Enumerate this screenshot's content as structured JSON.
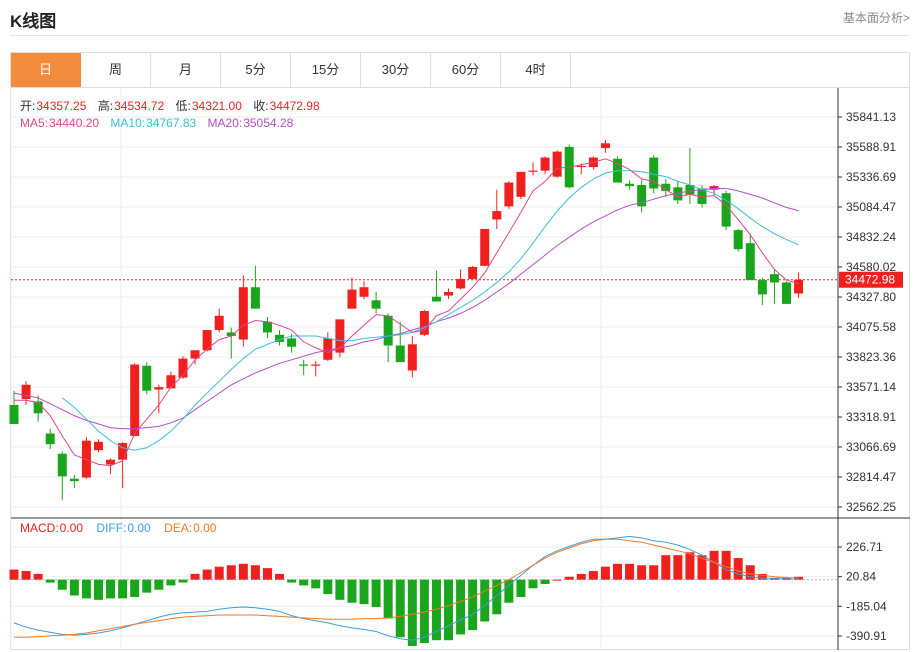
{
  "header": {
    "title": "K线图",
    "link": "基本面分析>"
  },
  "tabs": [
    "日",
    "周",
    "月",
    "5分",
    "15分",
    "30分",
    "60分",
    "4时"
  ],
  "active_tab": 0,
  "ohlc": {
    "open_label": "开:",
    "open": "34357.25",
    "high_label": "高:",
    "high": "34534.72",
    "low_label": "低:",
    "low": "34321.00",
    "close_label": "收:",
    "close": "34472.98"
  },
  "ma": {
    "ma5_label": "MA5:",
    "ma5": "34440.20",
    "ma10_label": "MA10:",
    "ma10": "34767.83",
    "ma20_label": "MA20:",
    "ma20": "35054.28"
  },
  "macd_legend": {
    "macd_label": "MACD:",
    "macd": "0.00",
    "diff_label": "DIFF:",
    "diff": "0.00",
    "dea_label": "DEA:",
    "dea": "0.00"
  },
  "colors": {
    "up": "#f0201e",
    "down": "#19a51c",
    "ma5": "#e0448c",
    "ma10": "#3bbfd6",
    "ma20": "#b14fc5",
    "diff": "#3b9fe0",
    "dea": "#f07a20",
    "accent": "#f28b3c"
  },
  "chart_data": [
    {
      "type": "candlestick",
      "y_ticks": [
        35841.13,
        35588.91,
        35336.69,
        35084.47,
        34832.24,
        34580.02,
        34327.8,
        34075.58,
        33823.36,
        33571.14,
        33318.91,
        33066.69,
        32814.47,
        32562.25
      ],
      "ylim": [
        32562.25,
        35841.13
      ],
      "last_price": "34472.98",
      "candles": [
        {
          "o": 33420,
          "h": 33540,
          "l": 33280,
          "c": 33260
        },
        {
          "o": 33470,
          "h": 33620,
          "l": 33420,
          "c": 33590
        },
        {
          "o": 33450,
          "h": 33500,
          "l": 33280,
          "c": 33350
        },
        {
          "o": 33180,
          "h": 33220,
          "l": 33050,
          "c": 33090
        },
        {
          "o": 33010,
          "h": 33030,
          "l": 32620,
          "c": 32820
        },
        {
          "o": 32800,
          "h": 32830,
          "l": 32720,
          "c": 32780
        },
        {
          "o": 32810,
          "h": 33150,
          "l": 32800,
          "c": 33120
        },
        {
          "o": 33040,
          "h": 33130,
          "l": 33020,
          "c": 33110
        },
        {
          "o": 32920,
          "h": 32970,
          "l": 32840,
          "c": 32960
        },
        {
          "o": 32960,
          "h": 33110,
          "l": 32720,
          "c": 33100
        },
        {
          "o": 33160,
          "h": 33770,
          "l": 33160,
          "c": 33760
        },
        {
          "o": 33750,
          "h": 33780,
          "l": 33510,
          "c": 33540
        },
        {
          "o": 33550,
          "h": 33590,
          "l": 33350,
          "c": 33570
        },
        {
          "o": 33560,
          "h": 33700,
          "l": 33560,
          "c": 33670
        },
        {
          "o": 33650,
          "h": 33830,
          "l": 33640,
          "c": 33810
        },
        {
          "o": 33810,
          "h": 33880,
          "l": 33760,
          "c": 33880
        },
        {
          "o": 33880,
          "h": 34050,
          "l": 33870,
          "c": 34050
        },
        {
          "o": 34050,
          "h": 34230,
          "l": 34030,
          "c": 34170
        },
        {
          "o": 34030,
          "h": 34070,
          "l": 33810,
          "c": 34000
        },
        {
          "o": 33970,
          "h": 34510,
          "l": 33910,
          "c": 34410
        },
        {
          "o": 34410,
          "h": 34590,
          "l": 34230,
          "c": 34230
        },
        {
          "o": 34120,
          "h": 34160,
          "l": 33980,
          "c": 34030
        },
        {
          "o": 34010,
          "h": 34050,
          "l": 33920,
          "c": 33950
        },
        {
          "o": 33980,
          "h": 34020,
          "l": 33860,
          "c": 33910
        },
        {
          "o": 33760,
          "h": 33800,
          "l": 33670,
          "c": 33750
        },
        {
          "o": 33750,
          "h": 33790,
          "l": 33660,
          "c": 33760
        },
        {
          "o": 33800,
          "h": 34030,
          "l": 33790,
          "c": 33980
        },
        {
          "o": 33860,
          "h": 34130,
          "l": 33820,
          "c": 34140
        },
        {
          "o": 34230,
          "h": 34490,
          "l": 34230,
          "c": 34390
        },
        {
          "o": 34330,
          "h": 34460,
          "l": 34310,
          "c": 34410
        },
        {
          "o": 34300,
          "h": 34370,
          "l": 34190,
          "c": 34230
        },
        {
          "o": 34170,
          "h": 34190,
          "l": 33780,
          "c": 33920
        },
        {
          "o": 33920,
          "h": 34120,
          "l": 33790,
          "c": 33780
        },
        {
          "o": 33710,
          "h": 34000,
          "l": 33650,
          "c": 33930
        },
        {
          "o": 34010,
          "h": 34220,
          "l": 34000,
          "c": 34210
        },
        {
          "o": 34330,
          "h": 34550,
          "l": 34300,
          "c": 34290
        },
        {
          "o": 34340,
          "h": 34400,
          "l": 34310,
          "c": 34370
        },
        {
          "o": 34400,
          "h": 34560,
          "l": 34390,
          "c": 34480
        },
        {
          "o": 34480,
          "h": 34590,
          "l": 34470,
          "c": 34580
        },
        {
          "o": 34590,
          "h": 34860,
          "l": 34590,
          "c": 34900
        },
        {
          "o": 34980,
          "h": 35230,
          "l": 34900,
          "c": 35050
        },
        {
          "o": 35090,
          "h": 35300,
          "l": 35070,
          "c": 35290
        },
        {
          "o": 35170,
          "h": 35330,
          "l": 35150,
          "c": 35380
        },
        {
          "o": 35380,
          "h": 35460,
          "l": 35350,
          "c": 35390
        },
        {
          "o": 35390,
          "h": 35510,
          "l": 35360,
          "c": 35500
        },
        {
          "o": 35340,
          "h": 35560,
          "l": 35330,
          "c": 35550
        },
        {
          "o": 35590,
          "h": 35610,
          "l": 35240,
          "c": 35250
        },
        {
          "o": 35420,
          "h": 35450,
          "l": 35360,
          "c": 35430
        },
        {
          "o": 35420,
          "h": 35510,
          "l": 35400,
          "c": 35500
        },
        {
          "o": 35580,
          "h": 35650,
          "l": 35540,
          "c": 35620
        },
        {
          "o": 35490,
          "h": 35510,
          "l": 35310,
          "c": 35290
        },
        {
          "o": 35280,
          "h": 35310,
          "l": 35230,
          "c": 35260
        },
        {
          "o": 35270,
          "h": 35310,
          "l": 35040,
          "c": 35090
        },
        {
          "o": 35500,
          "h": 35520,
          "l": 35200,
          "c": 35240
        },
        {
          "o": 35280,
          "h": 35320,
          "l": 35170,
          "c": 35220
        },
        {
          "o": 35250,
          "h": 35300,
          "l": 35110,
          "c": 35140
        },
        {
          "o": 35270,
          "h": 35580,
          "l": 35110,
          "c": 35190
        },
        {
          "o": 35240,
          "h": 35270,
          "l": 35080,
          "c": 35110
        },
        {
          "o": 35230,
          "h": 35270,
          "l": 35180,
          "c": 35260
        },
        {
          "o": 35200,
          "h": 35220,
          "l": 34890,
          "c": 34920
        },
        {
          "o": 34890,
          "h": 34900,
          "l": 34710,
          "c": 34730
        },
        {
          "o": 34780,
          "h": 34860,
          "l": 34620,
          "c": 34470
        },
        {
          "o": 34470,
          "h": 34490,
          "l": 34260,
          "c": 34350
        },
        {
          "o": 34520,
          "h": 34560,
          "l": 34270,
          "c": 34450
        },
        {
          "o": 34450,
          "h": 34460,
          "l": 34270,
          "c": 34270
        },
        {
          "o": 34357.25,
          "h": 34534.72,
          "l": 34321.0,
          "c": 34472.98
        }
      ],
      "ma5": [
        33460,
        33460,
        33440,
        33330,
        33160,
        33000,
        32960,
        32920,
        32910,
        32950,
        33180,
        33300,
        33420,
        33570,
        33670,
        33800,
        33890,
        33970,
        34000,
        34090,
        34130,
        34120,
        34090,
        34050,
        33950,
        33900,
        33860,
        33900,
        34000,
        34090,
        34180,
        34170,
        34100,
        34030,
        34050,
        34170,
        34210,
        34310,
        34410,
        34530,
        34700,
        34870,
        35040,
        35220,
        35300,
        35410,
        35420,
        35440,
        35460,
        35490,
        35450,
        35400,
        35320,
        35300,
        35230,
        35170,
        35190,
        35170,
        35180,
        35100,
        34980,
        34850,
        34700,
        34560,
        34470,
        34440.2
      ],
      "ma10": [
        null,
        null,
        null,
        null,
        33480,
        33400,
        33300,
        33200,
        33120,
        33060,
        33040,
        33060,
        33120,
        33200,
        33300,
        33420,
        33520,
        33620,
        33720,
        33810,
        33890,
        33930,
        33970,
        34000,
        34000,
        34000,
        33980,
        33960,
        33960,
        33980,
        33990,
        34000,
        34010,
        34030,
        34070,
        34120,
        34180,
        34240,
        34300,
        34370,
        34450,
        34540,
        34650,
        34780,
        34920,
        35050,
        35160,
        35250,
        35320,
        35370,
        35390,
        35390,
        35380,
        35360,
        35340,
        35300,
        35270,
        35230,
        35200,
        35140,
        35070,
        34990,
        34920,
        34860,
        34810,
        34767.83
      ],
      "ma20": [
        33520,
        33500,
        33480,
        33430,
        33380,
        33330,
        33290,
        33260,
        33230,
        33220,
        33220,
        33230,
        33240,
        33270,
        33310,
        33380,
        33450,
        33520,
        33590,
        33640,
        33690,
        33730,
        33770,
        33800,
        33830,
        33860,
        33880,
        33900,
        33920,
        33950,
        33970,
        34000,
        34020,
        34050,
        34080,
        34120,
        34150,
        34190,
        34240,
        34300,
        34370,
        34440,
        34520,
        34600,
        34680,
        34760,
        34830,
        34900,
        34960,
        35010,
        35060,
        35100,
        35120,
        35150,
        35180,
        35200,
        35220,
        35230,
        35240,
        35240,
        35220,
        35190,
        35160,
        35120,
        35080,
        35054.28
      ]
    },
    {
      "type": "macd",
      "y_ticks": [
        226.71,
        20.84,
        -185.04,
        -390.91
      ],
      "ylim": [
        -440,
        310
      ],
      "hist": [
        70,
        60,
        40,
        -20,
        -70,
        -110,
        -130,
        -140,
        -130,
        -130,
        -120,
        -90,
        -70,
        -40,
        -20,
        40,
        70,
        90,
        100,
        110,
        100,
        80,
        40,
        -20,
        -40,
        -60,
        -100,
        -140,
        -160,
        -170,
        -190,
        -270,
        -400,
        -460,
        -440,
        -420,
        -420,
        -380,
        -350,
        -290,
        -240,
        -160,
        -120,
        -60,
        -30,
        0,
        20,
        40,
        60,
        90,
        110,
        110,
        100,
        100,
        170,
        170,
        190,
        170,
        200,
        200,
        150,
        100,
        40,
        10,
        10,
        20
      ],
      "diff": [
        -300,
        -330,
        -350,
        -365,
        -380,
        -385,
        -380,
        -370,
        -355,
        -335,
        -310,
        -285,
        -260,
        -240,
        -230,
        -225,
        -220,
        -205,
        -195,
        -190,
        -195,
        -205,
        -220,
        -250,
        -270,
        -285,
        -300,
        -320,
        -335,
        -345,
        -360,
        -390,
        -410,
        -420,
        -400,
        -360,
        -320,
        -280,
        -240,
        -180,
        -110,
        -40,
        30,
        100,
        160,
        200,
        230,
        260,
        280,
        280,
        290,
        300,
        290,
        270,
        260,
        240,
        210,
        170,
        120,
        70,
        40,
        20,
        10,
        10,
        10,
        10
      ],
      "dea": [
        -400,
        -400,
        -395,
        -390,
        -385,
        -380,
        -370,
        -355,
        -340,
        -325,
        -310,
        -295,
        -285,
        -270,
        -260,
        -255,
        -250,
        -245,
        -245,
        -245,
        -245,
        -250,
        -255,
        -260,
        -265,
        -270,
        -275,
        -275,
        -275,
        -270,
        -270,
        -265,
        -255,
        -240,
        -225,
        -205,
        -180,
        -150,
        -120,
        -80,
        -40,
        0,
        50,
        100,
        150,
        190,
        220,
        250,
        270,
        280,
        280,
        270,
        260,
        240,
        220,
        200,
        180,
        150,
        120,
        90,
        60,
        40,
        30,
        20,
        15,
        10
      ]
    }
  ]
}
